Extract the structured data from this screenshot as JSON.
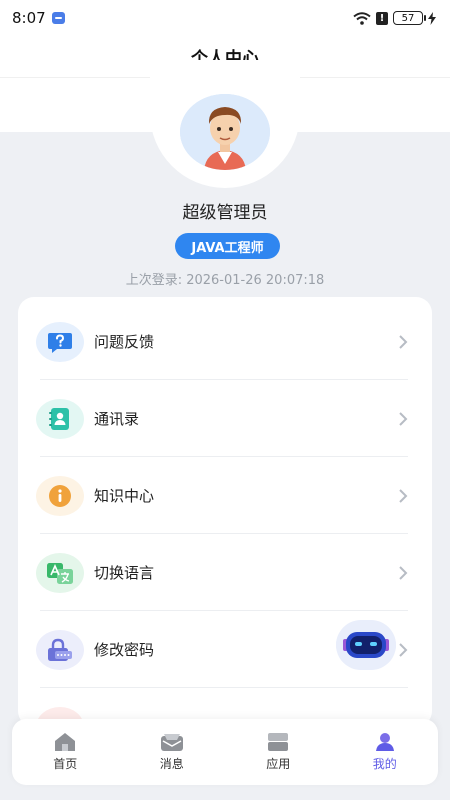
{
  "status": {
    "time": "8:07",
    "battery": "57"
  },
  "header": {
    "title": "个人中心"
  },
  "profile": {
    "name": "超级管理员",
    "role": "JAVA工程师",
    "last_login": "上次登录: 2026-01-26 20:07:18"
  },
  "menu": {
    "items": [
      {
        "label": "问题反馈",
        "icon": "question-icon",
        "color": "#2f7fe8"
      },
      {
        "label": "通讯录",
        "icon": "contacts-icon",
        "color": "#2dc1a8"
      },
      {
        "label": "知识中心",
        "icon": "info-icon",
        "color": "#f0a23b"
      },
      {
        "label": "切换语言",
        "icon": "translate-icon",
        "color": "#39b86a"
      },
      {
        "label": "修改密码",
        "icon": "lock-icon",
        "color": "#6b72d8"
      }
    ]
  },
  "tabs": [
    {
      "label": "首页",
      "icon": "home-icon"
    },
    {
      "label": "消息",
      "icon": "message-icon"
    },
    {
      "label": "应用",
      "icon": "apps-icon"
    },
    {
      "label": "我的",
      "icon": "profile-icon",
      "active": true
    }
  ]
}
